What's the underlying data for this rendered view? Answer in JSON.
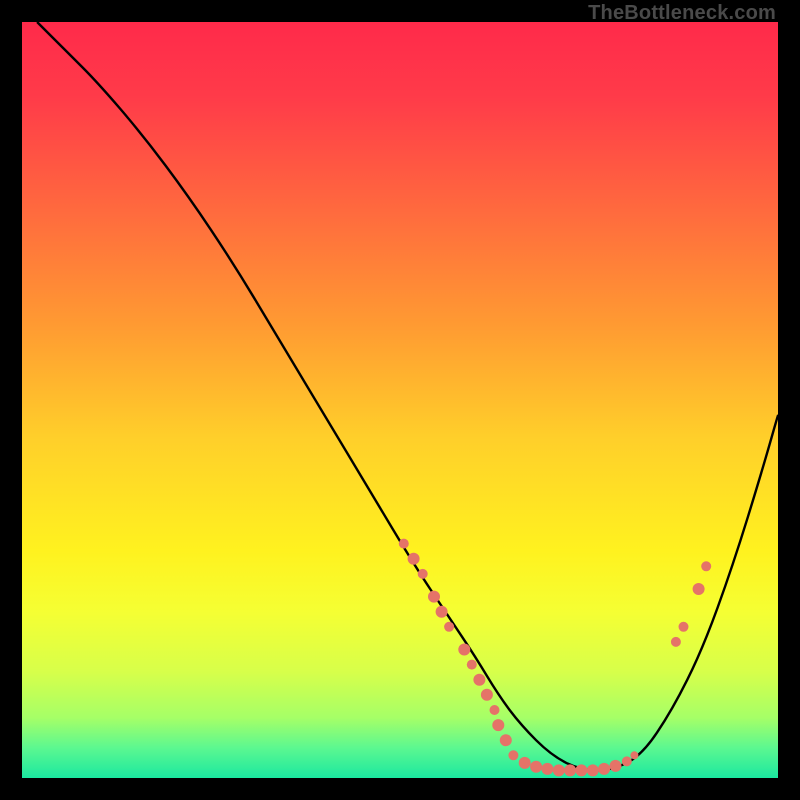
{
  "watermark": "TheBottleneck.com",
  "colors": {
    "bg_black": "#000000",
    "dot": "#e57368",
    "curve": "#000000",
    "gradient_stops": [
      {
        "offset": 0.0,
        "color": "#ff2a4a"
      },
      {
        "offset": 0.1,
        "color": "#ff3b49"
      },
      {
        "offset": 0.25,
        "color": "#ff6a3e"
      },
      {
        "offset": 0.4,
        "color": "#ff9a32"
      },
      {
        "offset": 0.55,
        "color": "#ffcf2a"
      },
      {
        "offset": 0.7,
        "color": "#fff21f"
      },
      {
        "offset": 0.78,
        "color": "#f5ff33"
      },
      {
        "offset": 0.86,
        "color": "#d7ff4a"
      },
      {
        "offset": 0.92,
        "color": "#a6ff67"
      },
      {
        "offset": 0.96,
        "color": "#5cf890"
      },
      {
        "offset": 1.0,
        "color": "#1be8a0"
      }
    ]
  },
  "chart_data": {
    "type": "line",
    "title": "",
    "xlabel": "",
    "ylabel": "",
    "xlim": [
      0,
      100
    ],
    "ylim": [
      0,
      100
    ],
    "series": [
      {
        "name": "curve",
        "x": [
          2,
          6,
          10,
          16,
          22,
          28,
          34,
          40,
          46,
          52,
          56,
          60,
          63,
          66,
          70,
          74,
          78,
          82,
          86,
          90,
          94,
          98,
          100
        ],
        "y": [
          100,
          96,
          92,
          85,
          77,
          68,
          58,
          48,
          38,
          28,
          22,
          16,
          11,
          7,
          3,
          1,
          1,
          3,
          9,
          17,
          28,
          41,
          48
        ]
      }
    ],
    "points": [
      {
        "x": 50.5,
        "y": 31,
        "r": 5
      },
      {
        "x": 51.8,
        "y": 29,
        "r": 6
      },
      {
        "x": 53.0,
        "y": 27,
        "r": 5
      },
      {
        "x": 54.5,
        "y": 24,
        "r": 6
      },
      {
        "x": 55.5,
        "y": 22,
        "r": 6
      },
      {
        "x": 56.5,
        "y": 20,
        "r": 5
      },
      {
        "x": 58.5,
        "y": 17,
        "r": 6
      },
      {
        "x": 59.5,
        "y": 15,
        "r": 5
      },
      {
        "x": 60.5,
        "y": 13,
        "r": 6
      },
      {
        "x": 61.5,
        "y": 11,
        "r": 6
      },
      {
        "x": 62.5,
        "y": 9,
        "r": 5
      },
      {
        "x": 63.0,
        "y": 7,
        "r": 6
      },
      {
        "x": 64.0,
        "y": 5,
        "r": 6
      },
      {
        "x": 65.0,
        "y": 3,
        "r": 5
      },
      {
        "x": 66.5,
        "y": 2,
        "r": 6
      },
      {
        "x": 68.0,
        "y": 1.5,
        "r": 6
      },
      {
        "x": 69.5,
        "y": 1.2,
        "r": 6
      },
      {
        "x": 71.0,
        "y": 1.0,
        "r": 6
      },
      {
        "x": 72.5,
        "y": 1.0,
        "r": 6
      },
      {
        "x": 74.0,
        "y": 1.0,
        "r": 6
      },
      {
        "x": 75.5,
        "y": 1.0,
        "r": 6
      },
      {
        "x": 77.0,
        "y": 1.2,
        "r": 6
      },
      {
        "x": 78.5,
        "y": 1.6,
        "r": 6
      },
      {
        "x": 80.0,
        "y": 2.2,
        "r": 5
      },
      {
        "x": 81.0,
        "y": 3.0,
        "r": 4
      },
      {
        "x": 86.5,
        "y": 18,
        "r": 5
      },
      {
        "x": 87.5,
        "y": 20,
        "r": 5
      },
      {
        "x": 89.5,
        "y": 25,
        "r": 6
      },
      {
        "x": 90.5,
        "y": 28,
        "r": 5
      }
    ]
  }
}
